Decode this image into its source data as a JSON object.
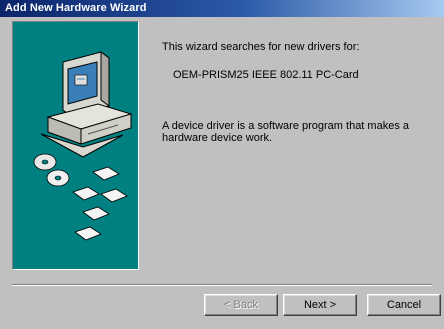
{
  "window": {
    "title": "Add New Hardware Wizard"
  },
  "content": {
    "intro": "This wizard searches for new drivers for:",
    "device_name": "OEM-PRISM25 IEEE 802.11 PC-Card",
    "description": "A device driver is a software program that makes a hardware device work."
  },
  "buttons": {
    "back": "< Back",
    "next": "Next >",
    "cancel": "Cancel"
  },
  "colors": {
    "art_background": "#008080",
    "title_bar_start": "#0a246a",
    "title_bar_end": "#a6caf0",
    "dialog_face": "#c0c0c0"
  },
  "icons": [
    "computer-icon",
    "cd-disc-icon",
    "floppy-disk-icon"
  ]
}
